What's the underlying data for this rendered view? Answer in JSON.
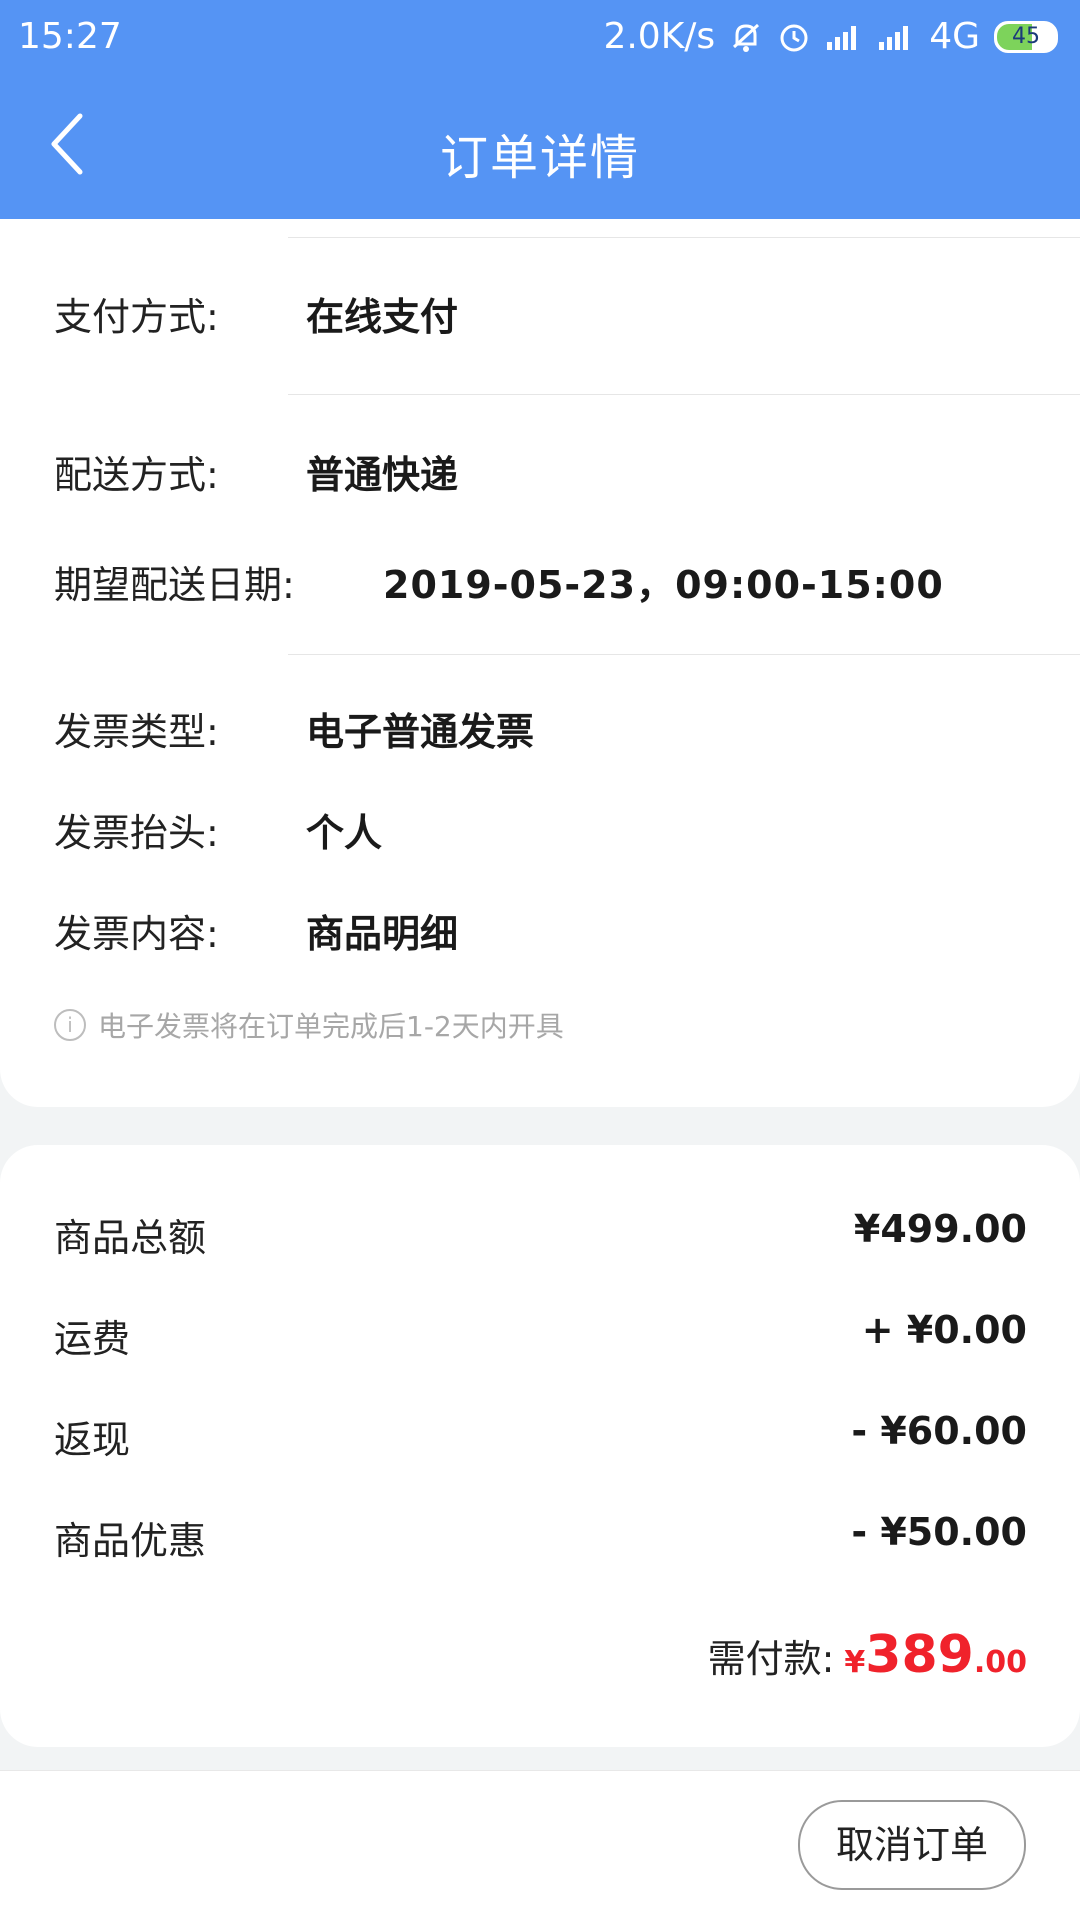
{
  "status_bar": {
    "time": "15:27",
    "network_speed": "2.0K/s",
    "network_type": "4G",
    "battery_level": "45"
  },
  "header": {
    "title": "订单详情",
    "back_icon": "chevron-left-icon"
  },
  "order_info": {
    "payment_label": "支付方式:",
    "payment_value": "在线支付",
    "delivery_label": "配送方式:",
    "delivery_value": "普通快递",
    "expected_date_label": "期望配送日期:",
    "expected_date_value": "2019-05-23，09:00-15:00",
    "invoice_type_label": "发票类型:",
    "invoice_type_value": "电子普通发票",
    "invoice_title_label": "发票抬头:",
    "invoice_title_value": "个人",
    "invoice_content_label": "发票内容:",
    "invoice_content_value": "商品明细",
    "invoice_notice": "电子发票将在订单完成后1-2天内开具"
  },
  "summary": {
    "items": [
      {
        "label": "商品总额",
        "value": "¥499.00"
      },
      {
        "label": "运费",
        "value": "+ ¥0.00"
      },
      {
        "label": "返现",
        "value": "- ¥60.00"
      },
      {
        "label": "商品优惠",
        "value": "- ¥50.00"
      }
    ],
    "total_label": "需付款:",
    "total_currency": "¥",
    "total_int": "389",
    "total_decimal": ".00"
  },
  "footer": {
    "cancel_label": "取消订单"
  },
  "colors": {
    "header_bg": "#5594f4",
    "price_red": "#f0222b"
  }
}
